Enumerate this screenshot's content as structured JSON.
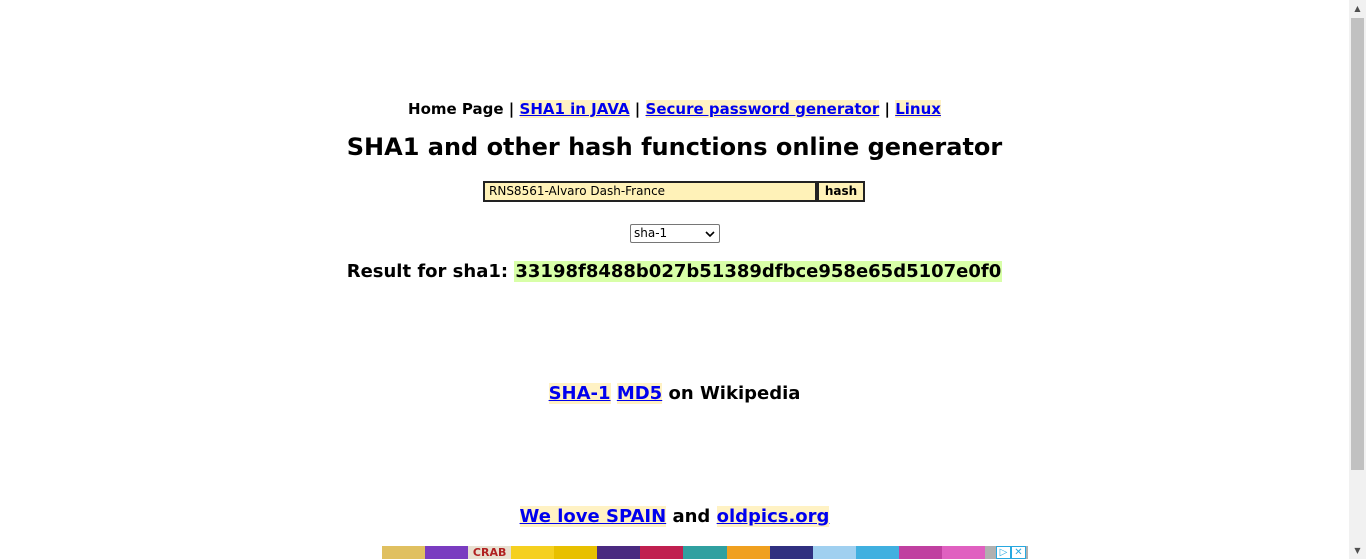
{
  "nav": {
    "home": "Home Page",
    "sep": "|",
    "link_java": "SHA1 in JAVA",
    "link_password": "Secure password generator",
    "link_linux": "Linux"
  },
  "title": "SHA1 and other hash functions online generator",
  "form": {
    "input_value": "RNS8561-Alvaro Dash-France",
    "button_label": "hash"
  },
  "select": {
    "selected": "sha-1"
  },
  "result": {
    "label": "Result for sha1:",
    "hash": "33198f8488b027b51389dfbce958e65d5107e0f0"
  },
  "wiki": {
    "link_sha1": "SHA-1",
    "link_md5": "MD5",
    "suffix": "on Wikipedia"
  },
  "bottom": {
    "link_spain": "We love SPAIN",
    "and": "and",
    "link_oldpics": "oldpics.org"
  },
  "ad": {
    "banner_text": "CRAB",
    "tile_colors": [
      "#e0c060",
      "#7a3cc0",
      "#e8e0d0",
      "#f5d020",
      "#e8c000",
      "#4a2a80",
      "#c02050",
      "#30a0a0",
      "#f0a020",
      "#303080",
      "#a0d0f0",
      "#40b0e0",
      "#c040a0",
      "#e060c0",
      "#b0b0b0"
    ]
  },
  "colors": {
    "link": "#0000ee",
    "link_highlight": "#fff2c4",
    "input_bg": "#fff2b8",
    "hash_highlight": "#d8ffa8"
  }
}
